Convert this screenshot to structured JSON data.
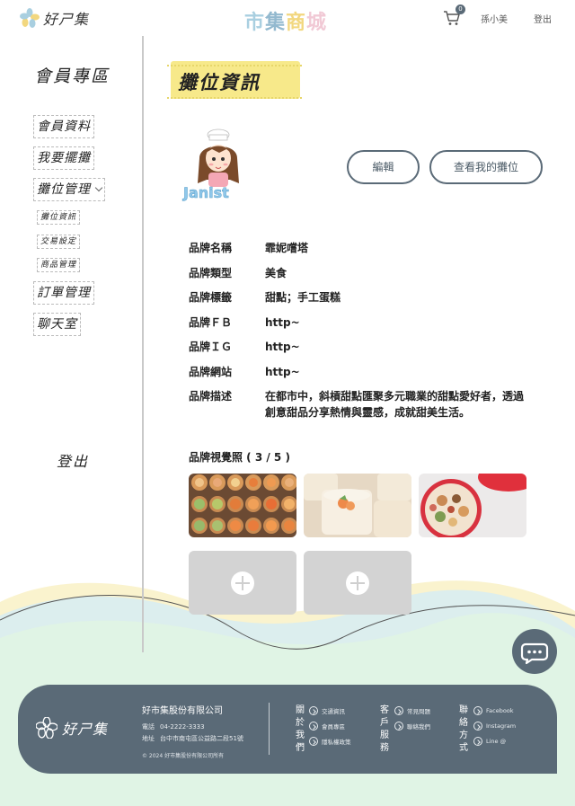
{
  "header": {
    "logo_text": "好ㄕ集",
    "site_title_chars": [
      "市",
      "集",
      "商",
      "城"
    ],
    "site_title_colors": [
      "#a9cfe0",
      "#93b9cf",
      "#f2d77f",
      "#f1c9d5"
    ],
    "cart_icon": "cart-icon",
    "cart_count": "0",
    "user_name": "孫小美",
    "logout": "登出"
  },
  "sidebar": {
    "title": "會員專區",
    "items": [
      {
        "label": "會員資料"
      },
      {
        "label": "我要擺攤"
      },
      {
        "label": "攤位管理"
      },
      {
        "label": "訂單管理"
      },
      {
        "label": "聊天室"
      }
    ],
    "sub_items": [
      {
        "label": "攤位資訊"
      },
      {
        "label": "交易設定"
      },
      {
        "label": "商品管理"
      }
    ],
    "logout": "登出"
  },
  "main": {
    "title": "攤位資訊",
    "avatar_text": "Janist",
    "edit_button": "編輯",
    "view_button": "查看我的攤位",
    "info": [
      {
        "label": "品牌名稱",
        "value": "霏妮嚐塔"
      },
      {
        "label": "品牌類型",
        "value": "美食"
      },
      {
        "label": "品牌標籤",
        "value": "甜點；手工蛋糕"
      },
      {
        "label": "品牌ＦＢ",
        "value": "http~"
      },
      {
        "label": "品牌ＩＧ",
        "value": "http~"
      },
      {
        "label": "品牌網站",
        "value": "http~"
      },
      {
        "label": "品牌描述",
        "value": "在都市中，斜槓甜點匯聚多元職業的甜點愛好者，透過創意甜品分享熱情與靈感，成就甜美生活。"
      }
    ],
    "photos_title": "品牌視覺照 ( 3 / 5 )"
  },
  "footer": {
    "logo_text": "好ㄕ集",
    "company": "好市集股份有限公司",
    "phone_label": "電話",
    "phone": "04-2222-3333",
    "address_label": "地址",
    "address": "台中市南屯區公益路二段51號",
    "copyright": "© 2024 好市集股份有限公司所有",
    "col1_title": "關於我們",
    "col1_links": [
      "交通資訊",
      "會員專區",
      "隱私權政策"
    ],
    "col2_title": "客戶服務",
    "col2_links": [
      "常見問題",
      "聯絡我們"
    ],
    "col3_title": "聯絡方式",
    "col3_links": [
      "Facebook",
      "Instagram",
      "Line @"
    ]
  },
  "chat_icon": "chat-bubble-icon"
}
